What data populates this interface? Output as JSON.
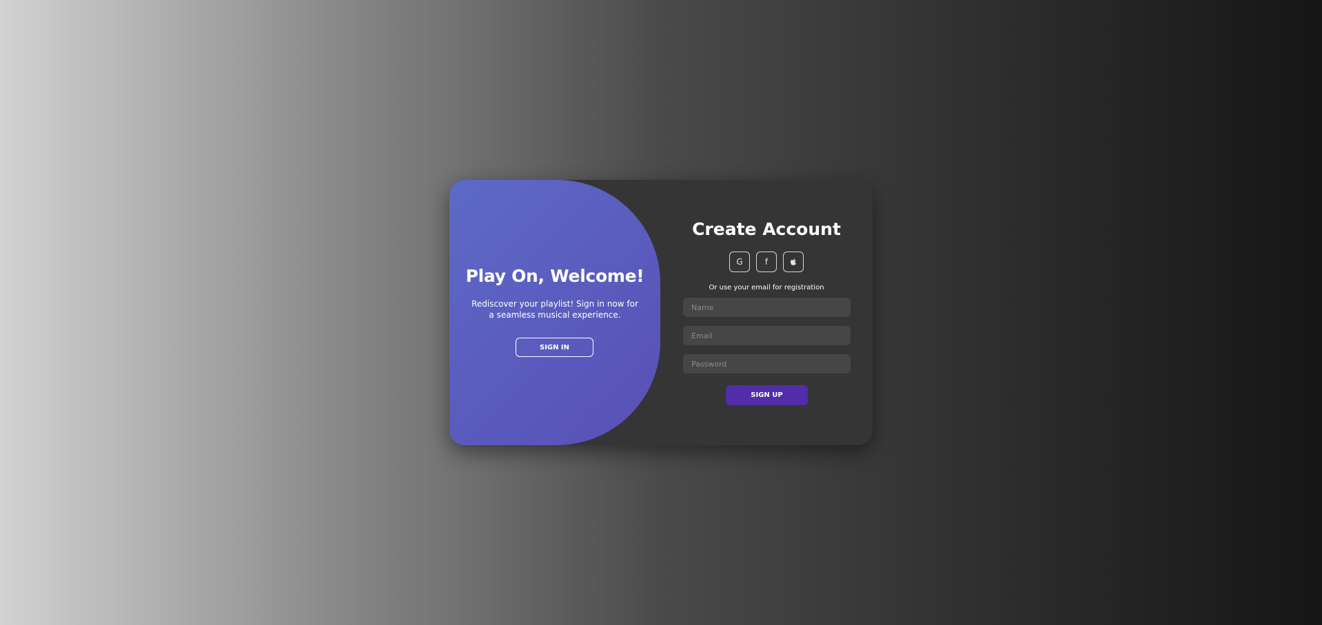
{
  "welcome_panel": {
    "title": "Play On, Welcome!",
    "subtitle": "Rediscover your playlist! Sign in now for a seamless musical experience.",
    "sign_in_label": "SIGN IN"
  },
  "signup_form": {
    "title": "Create Account",
    "social_buttons": [
      {
        "icon": "google-icon",
        "glyph": "G"
      },
      {
        "icon": "facebook-icon",
        "glyph": "f"
      },
      {
        "icon": "apple-icon",
        "glyph": ""
      }
    ],
    "alt_text": "Or use your email for registration",
    "name_placeholder": "Name",
    "email_placeholder": "Email",
    "password_placeholder": "Password",
    "submit_label": "SIGN UP"
  },
  "colors": {
    "accent": "#512da8",
    "panel_gradient_start": "#5d6ac7",
    "panel_gradient_end": "#594fb5",
    "card_bg": "#353535",
    "input_bg": "#464646"
  }
}
